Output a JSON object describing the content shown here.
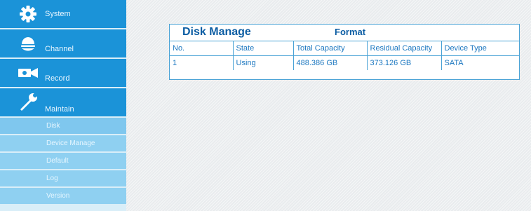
{
  "sidebar": {
    "main_items": [
      {
        "label": "System",
        "icon": "gear-icon"
      },
      {
        "label": "Channel",
        "icon": "camera-dome-icon"
      },
      {
        "label": "Record",
        "icon": "video-camera-icon"
      },
      {
        "label": "Maintain",
        "icon": "wrench-icon"
      }
    ],
    "sub_items": [
      {
        "label": "Disk"
      },
      {
        "label": "Device Manage"
      },
      {
        "label": "Default"
      },
      {
        "label": "Log"
      },
      {
        "label": "Version"
      }
    ]
  },
  "panel": {
    "title": "Disk Manage",
    "format_label": "Format",
    "columns": [
      "No.",
      "State",
      "Total Capacity",
      "Residual Capacity",
      "Device Type"
    ],
    "rows": [
      [
        "1",
        "Using",
        "488.386 GB",
        "373.126 GB",
        "SATA"
      ]
    ]
  },
  "colors": {
    "sidebar_main": "#1b93d8",
    "sidebar_sub": "#8fd0f1",
    "panel_border": "#4aa3d6",
    "title_text": "#0c5da3",
    "cell_text": "#1b77c0"
  }
}
